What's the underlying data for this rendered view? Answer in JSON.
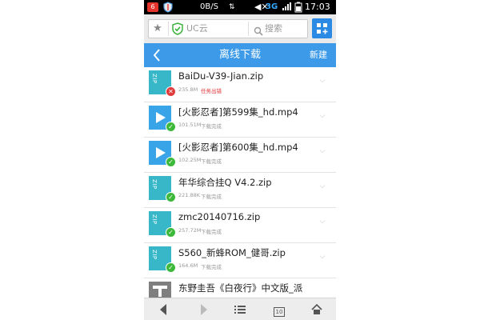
{
  "status_bar": {
    "notification_count": "6",
    "net_speed": "0B/S",
    "network_type": "3G",
    "time": "17:03"
  },
  "search_bar": {
    "url_label": "UC云",
    "search_label": "搜索"
  },
  "title_bar": {
    "title": "离线下载",
    "new_label": "新建"
  },
  "downloads": [
    {
      "name": "BaiDu-V39-Jian.zip",
      "size": "235.8M",
      "status": "任务出错",
      "type": "zip",
      "state": "error"
    },
    {
      "name": "[火影忍者]第599集_hd.mp4",
      "size": "101.51M",
      "status": "下载完成",
      "type": "video",
      "state": "done"
    },
    {
      "name": "[火影忍者]第600集_hd.mp4",
      "size": "102.25M",
      "status": "下载完成",
      "type": "video",
      "state": "done"
    },
    {
      "name": "年华综合挂Q V4.2.zip",
      "size": "221.88K",
      "status": "下载完成",
      "type": "zip",
      "state": "done"
    },
    {
      "name": "zmc20140716.zip",
      "size": "257.72M",
      "status": "下载完成",
      "type": "zip",
      "state": "done"
    },
    {
      "name": "S560_新蜂ROM_健哥.zip",
      "size": "164.6M",
      "status": "下载完成",
      "type": "zip",
      "state": "done"
    },
    {
      "name": "东野圭吾《白夜行》中文版_派",
      "size": "",
      "status": "",
      "type": "doc",
      "state": ""
    }
  ],
  "nav_bar": {
    "window_count": "10"
  },
  "colors": {
    "accent_blue": "#3c9ae8",
    "zip_teal": "#37b7c8",
    "success_green": "#3db93a",
    "error_red": "#e03a3a"
  },
  "icons": {
    "zip_label": "ZIP"
  }
}
